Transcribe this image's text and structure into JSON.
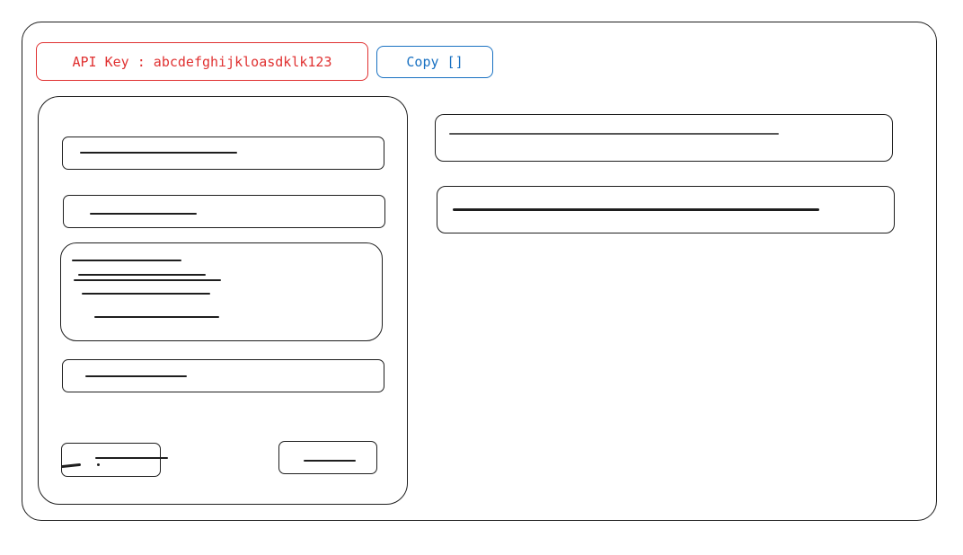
{
  "header": {
    "api_key_text": "API Key : abcdefghijkloasdklk123",
    "copy_label": "Copy []"
  },
  "colors": {
    "api_key_accent": "#e03131",
    "copy_accent": "#1971c2",
    "stroke": "#1e1e1e"
  }
}
